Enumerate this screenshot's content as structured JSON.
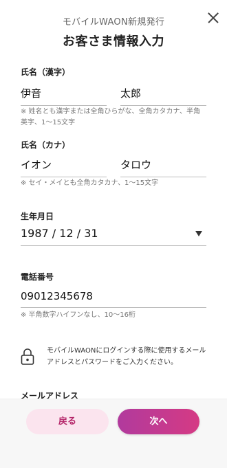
{
  "header": {
    "subtitle": "モバイルWAON新規発行",
    "title": "お客さま情報入力",
    "close_icon": "close-icon"
  },
  "name_kanji": {
    "label": "氏名（漢字）",
    "last_name": "伊音",
    "first_name": "太郎",
    "note": "※ 姓名とも漢字または全角ひらがな、全角カタカナ、半角英字、1〜15文字"
  },
  "name_kana": {
    "label": "氏名（カナ）",
    "last_name": "イオン",
    "first_name": "タロウ",
    "note": "※ セイ・メイとも全角カタカナ、1〜15文字"
  },
  "birthdate": {
    "label": "生年月日",
    "value": "1987 / 12 / 31",
    "icon": "dropdown-arrow-icon"
  },
  "phone": {
    "label": "電話番号",
    "value": "09012345678",
    "note": "※ 半角数字ハイフンなし、10〜16桁"
  },
  "info": {
    "icon": "lock-icon",
    "text": "モバイルWAONにログインする際に使用するメールアドレスとパスワードをご入力ください。"
  },
  "email": {
    "label": "メールアドレス"
  },
  "footer": {
    "back_label": "戻る",
    "next_label": "次へ"
  },
  "colors": {
    "accent_start": "#b13a9d",
    "accent_end": "#d53a84",
    "back_bg": "#fbe4ee",
    "back_text": "#b5276a"
  }
}
